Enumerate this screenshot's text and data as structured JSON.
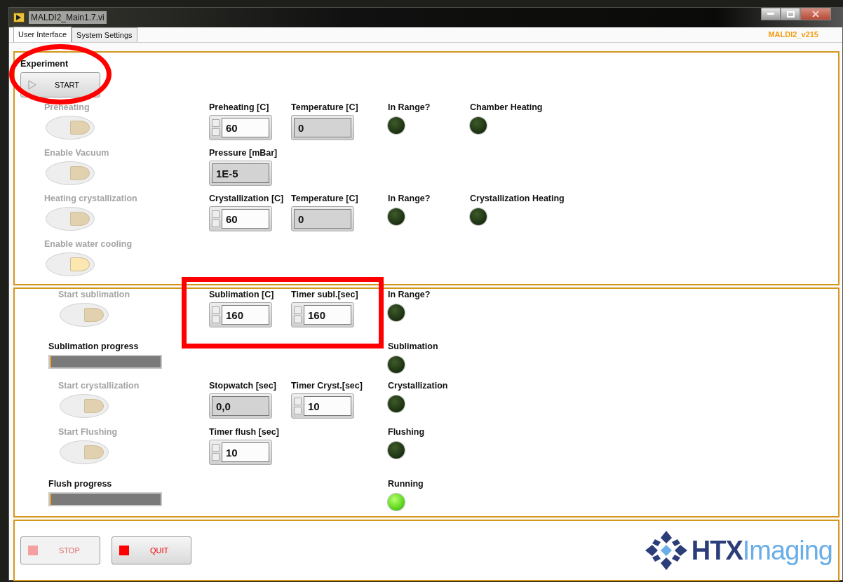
{
  "window": {
    "title": "MALDI2_Main1.7.vi",
    "version": "MALDI2_v215"
  },
  "tabs": [
    {
      "label": "User Interface",
      "selected": true
    },
    {
      "label": "System Settings",
      "selected": false
    }
  ],
  "experiment": {
    "label": "Experiment",
    "start_button": "START"
  },
  "heating_panel": {
    "rows": [
      {
        "left": {
          "kind": "toggle",
          "label": "Preheating",
          "disabled": true,
          "lit": false
        },
        "controls": [
          {
            "kind": "numeric",
            "label": "Preheating [C]",
            "value": "60"
          },
          {
            "kind": "indicator",
            "label": "Temperature [C]",
            "value": "0"
          }
        ],
        "leds": [
          {
            "label": "In Range?",
            "on": false
          },
          {
            "label": "Chamber Heating",
            "on": false
          }
        ]
      },
      {
        "left": {
          "kind": "toggle",
          "label": "Enable Vacuum",
          "disabled": true,
          "lit": false
        },
        "controls": [
          {
            "kind": "indicator",
            "label": "Pressure [mBar]",
            "value": "1E-5"
          }
        ],
        "leds": []
      },
      {
        "left": {
          "kind": "toggle",
          "label": "Heating crystallization",
          "disabled": true,
          "lit": false
        },
        "controls": [
          {
            "kind": "numeric",
            "label": "Crystallization [C]",
            "value": "60"
          },
          {
            "kind": "indicator",
            "label": "Temperature [C]",
            "value": "0"
          }
        ],
        "leds": [
          {
            "label": "In Range?",
            "on": false
          },
          {
            "label": "Crystallization Heating",
            "on": false
          }
        ]
      },
      {
        "left": {
          "kind": "toggle",
          "label": "Enable water cooling",
          "disabled": true,
          "lit": true
        },
        "controls": [],
        "leds": []
      }
    ]
  },
  "process_panel": {
    "rows": [
      {
        "left": {
          "kind": "toggle",
          "label": "Start sublimation",
          "disabled": true,
          "lit": false
        },
        "controls": [
          {
            "kind": "numeric",
            "label": "Sublimation [C]",
            "value": "160"
          },
          {
            "kind": "numeric",
            "label": "Timer subl.[sec]",
            "value": "160"
          }
        ],
        "leds": [
          {
            "label": "In Range?",
            "on": false
          }
        ]
      },
      {
        "left": {
          "kind": "progress",
          "label": "Sublimation progress",
          "level": 0.01
        },
        "controls": [],
        "leds": [
          {
            "label": "Sublimation",
            "on": false
          }
        ]
      },
      {
        "left": {
          "kind": "toggle",
          "label": "Start crystallization",
          "disabled": true,
          "lit": false
        },
        "controls": [
          {
            "kind": "indicator",
            "label": "Stopwatch [sec]",
            "value": "0,0"
          },
          {
            "kind": "numeric",
            "label": "Timer Cryst.[sec]",
            "value": "10"
          }
        ],
        "leds": [
          {
            "label": "Crystallization",
            "on": false
          }
        ]
      },
      {
        "left": {
          "kind": "toggle",
          "label": "Start Flushing",
          "disabled": true,
          "lit": false
        },
        "controls": [
          {
            "kind": "numeric",
            "label": "Timer flush [sec]",
            "value": "10"
          }
        ],
        "leds": [
          {
            "label": "Flushing",
            "on": false
          }
        ]
      },
      {
        "left": {
          "kind": "progress",
          "label": "Flush progress",
          "level": 0.01
        },
        "controls": [],
        "leds": [
          {
            "label": "Running",
            "on": true
          }
        ]
      }
    ]
  },
  "footer": {
    "buttons": [
      {
        "label": "STOP",
        "disabled": true
      },
      {
        "label": "QUIT",
        "disabled": false
      }
    ],
    "logo": {
      "strong": "HTX",
      "light": "Imaging"
    }
  },
  "annotations": [
    {
      "kind": "ellipse"
    },
    {
      "kind": "rectangle"
    }
  ]
}
